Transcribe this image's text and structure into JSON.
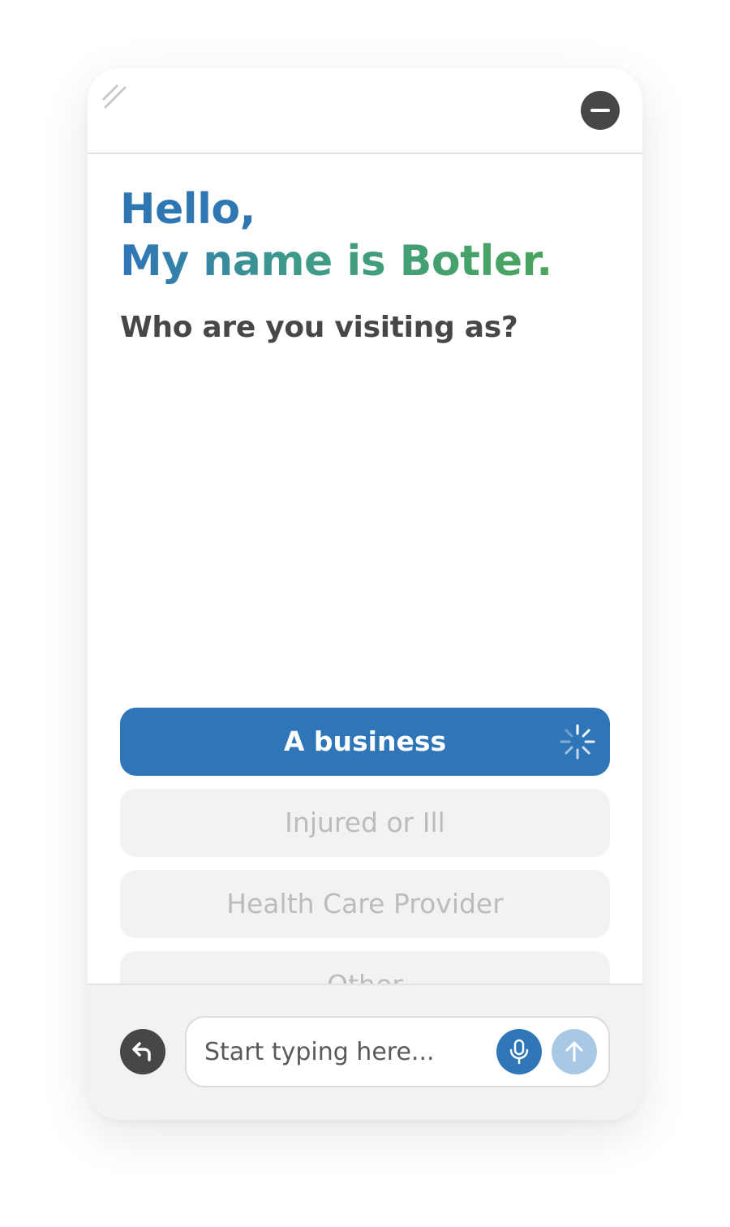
{
  "header": {
    "grip_icon": "grip-lines-icon",
    "minimize_icon": "minus-circle-icon"
  },
  "greeting": {
    "line1": "Hello,",
    "line2": "My name is Botler."
  },
  "question": "Who are you visiting as?",
  "options": [
    {
      "label": "A business",
      "state": "selected-loading"
    },
    {
      "label": "Injured or Ill",
      "state": "disabled"
    },
    {
      "label": "Health Care Provider",
      "state": "disabled"
    },
    {
      "label": "Other",
      "state": "disabled"
    }
  ],
  "footer": {
    "back_icon": "undo-arrow-icon",
    "input_placeholder": "Start typing here...",
    "mic_icon": "microphone-icon",
    "send_icon": "arrow-up-icon"
  },
  "colors": {
    "primary_blue": "#2f76b9",
    "accent_green": "#4aa55c",
    "dark_gray": "#474747",
    "disabled_bg": "#f2f2f2",
    "disabled_text": "#bcbcbc",
    "send_disabled": "#a9c8e6"
  }
}
